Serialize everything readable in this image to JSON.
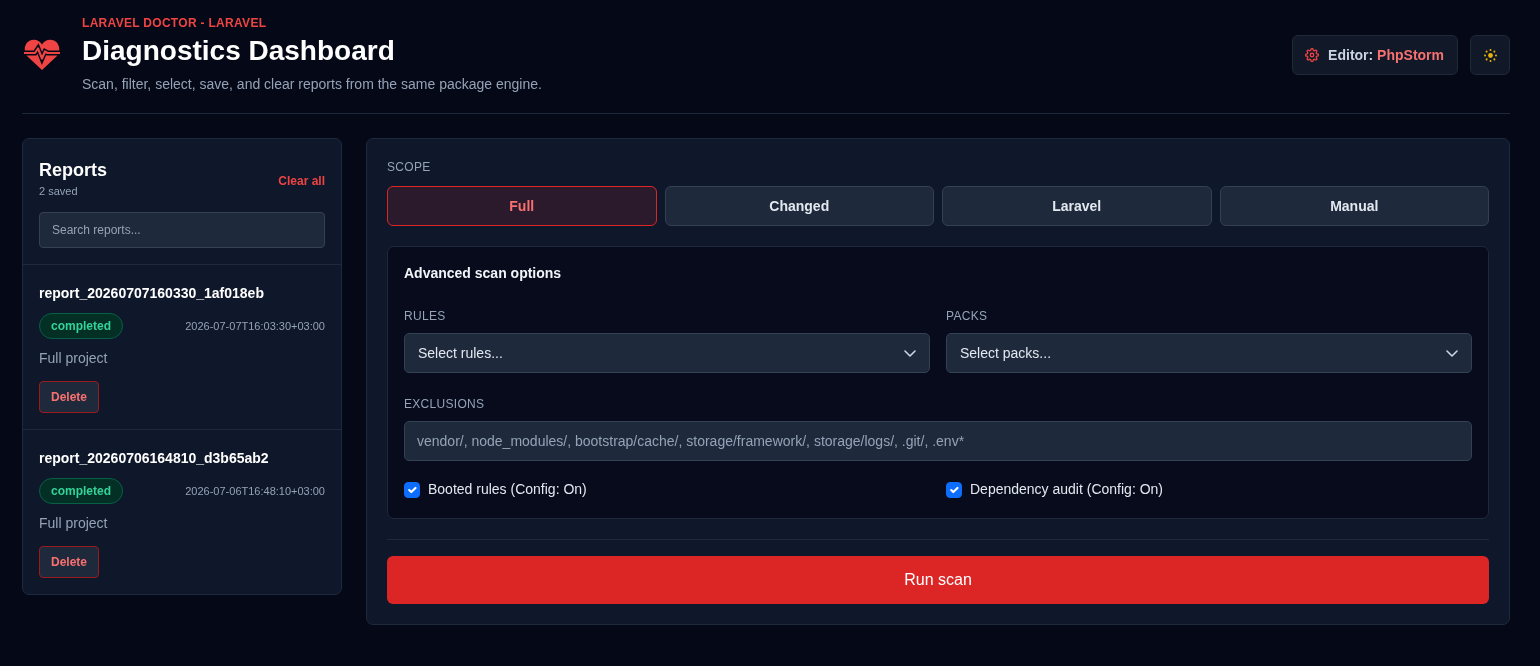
{
  "header": {
    "eyebrow": "LARAVEL DOCTOR - LARAVEL",
    "title": "Diagnostics Dashboard",
    "subtitle": "Scan, filter, select, save, and clear reports from the same package engine.",
    "editor_button": {
      "label": "Editor:",
      "value": "PhpStorm"
    }
  },
  "reports": {
    "title": "Reports",
    "count": "2 saved",
    "clear_button": "Clear all",
    "search": {
      "placeholder": "Search reports..."
    },
    "items": [
      {
        "name": "report_20260707160330_1af018eb",
        "status": "completed",
        "timestamp": "2026-07-07T16:03:30+03:00",
        "scope": "Full project",
        "delete_button": "Delete"
      },
      {
        "name": "report_20260706164810_d3b65ab2",
        "status": "completed",
        "timestamp": "2026-07-06T16:48:10+03:00",
        "scope": "Full project",
        "delete_button": "Delete"
      }
    ]
  },
  "scan": {
    "scope_label": "SCOPE",
    "scopes": [
      {
        "label": "Full",
        "selected": true
      },
      {
        "label": "Changed",
        "selected": false
      },
      {
        "label": "Laravel",
        "selected": false
      },
      {
        "label": "Manual",
        "selected": false
      }
    ],
    "advanced": {
      "title": "Advanced scan options",
      "rules": {
        "label": "RULES",
        "placeholder": "Select rules..."
      },
      "packs": {
        "label": "PACKS",
        "placeholder": "Select packs..."
      },
      "exclusions": {
        "label": "EXCLUSIONS",
        "placeholder": "vendor/, node_modules/, bootstrap/cache/, storage/framework/, storage/logs/, .git/, .env*"
      },
      "options": [
        {
          "label": "Booted rules (Config: On)",
          "checked": true
        },
        {
          "label": "Dependency audit (Config: On)",
          "checked": true
        }
      ]
    },
    "run_button": "Run scan"
  }
}
